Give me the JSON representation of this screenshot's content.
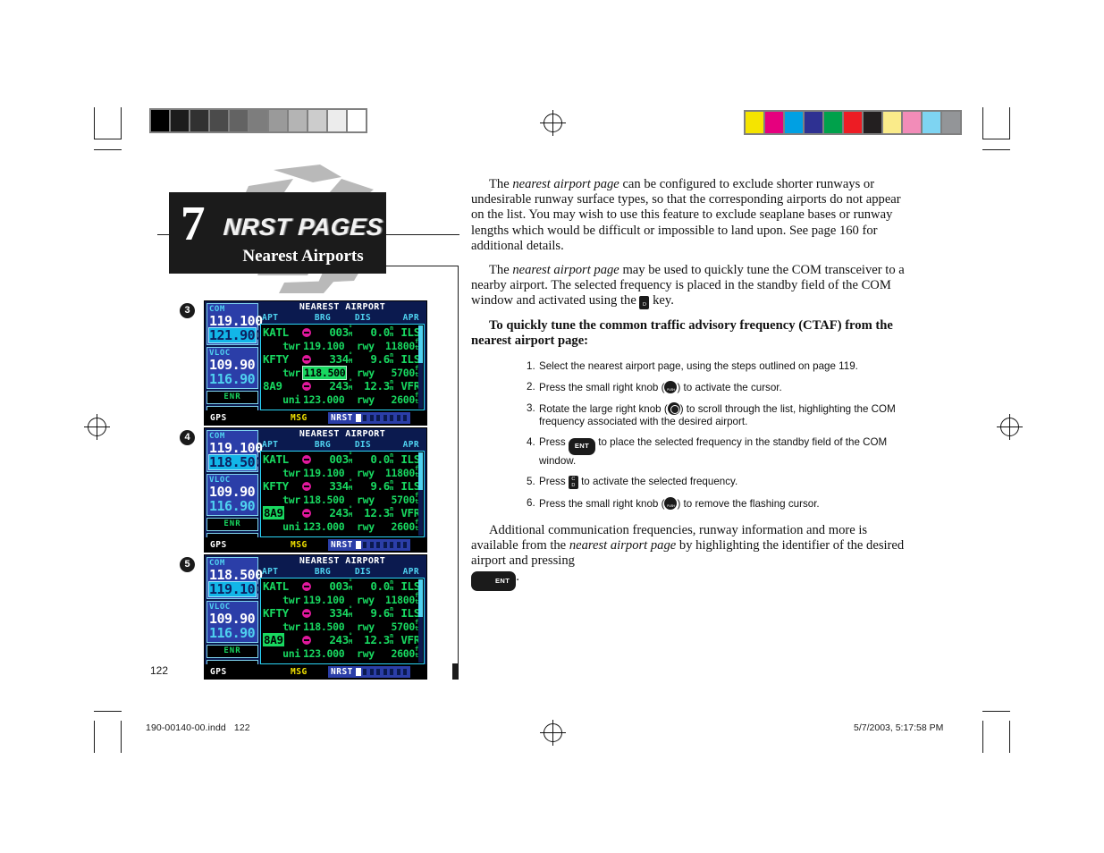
{
  "document": {
    "page_number": "122",
    "footer_filename": "190-00140-00.indd",
    "footer_page": "122",
    "footer_timestamp": "5/7/2003, 5:17:58 PM"
  },
  "chapter": {
    "number": "7",
    "kicker": "NRST PAGES",
    "title": "Nearest Airports"
  },
  "body": {
    "para1_a": "The ",
    "para1_em": "nearest airport page",
    "para1_b": " can be configured to exclude shorter runways or undesirable runway surface types, so that the corresponding airports do not appear on the list. You may wish to use this feature to exclude seaplane bases or runway lengths which would be difficult or impossible to land upon.  See page 160 for additional details.",
    "para2_a": "The ",
    "para2_em": "nearest airport page",
    "para2_b": " may be used to quickly tune the COM transceiver to a nearby airport. The selected frequency is placed in the standby field of the COM window and activated using the ",
    "para2_c": " key.",
    "lead_in": "To quickly tune the common traffic advisory frequency (CTAF) from the nearest airport page:",
    "para3_a": "Additional communication frequencies, runway information and more is available from the ",
    "para3_em": "nearest airport page",
    "para3_b": " by highlighting the identifier of the desired airport and pressing ",
    "para3_c": "."
  },
  "steps": [
    {
      "num": "1.",
      "text_a": "Select the nearest airport page, using the steps outlined on page 119.",
      "glyph": "",
      "text_b": ""
    },
    {
      "num": "2.",
      "text_a": "Press the small right knob (",
      "glyph": "knob-small",
      "text_b": ") to activate the cursor."
    },
    {
      "num": "3.",
      "text_a": "Rotate the large right knob (",
      "glyph": "knob-large",
      "text_b": ") to scroll through the list, highlighting the COM frequency associated with the desired airport."
    },
    {
      "num": "4.",
      "text_a": "Press ",
      "glyph": "key-ent",
      "text_b": " to place the selected frequency in the standby field of the COM window."
    },
    {
      "num": "5.",
      "text_a": "Press ",
      "glyph": "key-cd",
      "text_b": " to activate the selected frequency."
    },
    {
      "num": "6.",
      "text_a": "Press the small right knob (",
      "glyph": "knob-small",
      "text_b": ") to remove the flashing cursor."
    }
  ],
  "keys": {
    "ent_label": "ENT",
    "cd_top": "C",
    "cd_bottom": "D"
  },
  "gps_common": {
    "title": "NEAREST AIRPORT",
    "columns": [
      "APT",
      "BRG",
      "DIS",
      "APR"
    ],
    "com_label": "COM",
    "vloc_label": "VLOC",
    "enr_label": "ENR",
    "status_gps": "GPS",
    "status_msg": "MSG",
    "status_nrst": "NRST",
    "page_dots_total": 8,
    "page_dots_active": 1,
    "colors": {
      "screen_bg": "#0b1a4f",
      "list_bg": "#000000",
      "list_border": "#2bd4f5",
      "green": "#18d860",
      "cyan": "#4fd2f0",
      "magenta": "#e0189c",
      "yellow": "#f2e200",
      "blue_box": "#2b3ea8"
    }
  },
  "figures": [
    {
      "badge": "3",
      "com_active": "119.100",
      "com_standby": "121.900",
      "com_standby_boxed": true,
      "vloc_active": "109.90",
      "vloc_standby": "116.90",
      "rows": [
        {
          "id": "KATL",
          "id_highlight": false,
          "brg": "003",
          "dis": "0.0",
          "apr": "ILS",
          "freq_label": "twr",
          "freq": "119.100",
          "freq_highlight": "none",
          "rwy_label": "rwy",
          "rwy_len": "11800"
        },
        {
          "id": "KFTY",
          "id_highlight": false,
          "brg": "334",
          "dis": "9.6",
          "apr": "ILS",
          "freq_label": "twr",
          "freq": "118.500",
          "freq_highlight": "cursor",
          "rwy_label": "rwy",
          "rwy_len": "5700"
        },
        {
          "id": "8A9",
          "id_highlight": false,
          "brg": "243",
          "dis": "12.3",
          "apr": "VFR",
          "freq_label": "uni",
          "freq": "123.000",
          "freq_highlight": "none",
          "rwy_label": "rwy",
          "rwy_len": "2600"
        }
      ]
    },
    {
      "badge": "4",
      "com_active": "119.100",
      "com_standby": "118.500",
      "com_standby_boxed": true,
      "vloc_active": "109.90",
      "vloc_standby": "116.90",
      "rows": [
        {
          "id": "KATL",
          "id_highlight": false,
          "brg": "003",
          "dis": "0.0",
          "apr": "ILS",
          "freq_label": "twr",
          "freq": "119.100",
          "freq_highlight": "none",
          "rwy_label": "rwy",
          "rwy_len": "11800"
        },
        {
          "id": "KFTY",
          "id_highlight": false,
          "brg": "334",
          "dis": "9.6",
          "apr": "ILS",
          "freq_label": "twr",
          "freq": "118.500",
          "freq_highlight": "none",
          "rwy_label": "rwy",
          "rwy_len": "5700"
        },
        {
          "id": "8A9",
          "id_highlight": true,
          "brg": "243",
          "dis": "12.3",
          "apr": "VFR",
          "freq_label": "uni",
          "freq": "123.000",
          "freq_highlight": "none",
          "rwy_label": "rwy",
          "rwy_len": "2600"
        }
      ]
    },
    {
      "badge": "5",
      "com_active": "118.500",
      "com_standby": "119.100",
      "com_standby_boxed": true,
      "vloc_active": "109.90",
      "vloc_standby": "116.90",
      "rows": [
        {
          "id": "KATL",
          "id_highlight": false,
          "brg": "003",
          "dis": "0.0",
          "apr": "ILS",
          "freq_label": "twr",
          "freq": "119.100",
          "freq_highlight": "none",
          "rwy_label": "rwy",
          "rwy_len": "11800"
        },
        {
          "id": "KFTY",
          "id_highlight": false,
          "brg": "334",
          "dis": "9.6",
          "apr": "ILS",
          "freq_label": "twr",
          "freq": "118.500",
          "freq_highlight": "none",
          "rwy_label": "rwy",
          "rwy_len": "5700"
        },
        {
          "id": "8A9",
          "id_highlight": true,
          "brg": "243",
          "dis": "12.3",
          "apr": "VFR",
          "freq_label": "uni",
          "freq": "123.000",
          "freq_highlight": "none",
          "rwy_label": "rwy",
          "rwy_len": "2600"
        }
      ]
    }
  ],
  "prepress": {
    "grayscale_patches": [
      "#000000",
      "#1c1c1c",
      "#313131",
      "#4b4b4b",
      "#636363",
      "#7d7d7d",
      "#9a9a9a",
      "#b4b4b4",
      "#cccccc",
      "#ececec",
      "#ffffff"
    ],
    "color_patches": [
      "#f5e400",
      "#e6007e",
      "#00a0e3",
      "#2e3192",
      "#00a14b",
      "#ed1c24",
      "#231f20",
      "#faeb8a",
      "#f28cb8",
      "#7ed4f2",
      "#939598"
    ]
  }
}
